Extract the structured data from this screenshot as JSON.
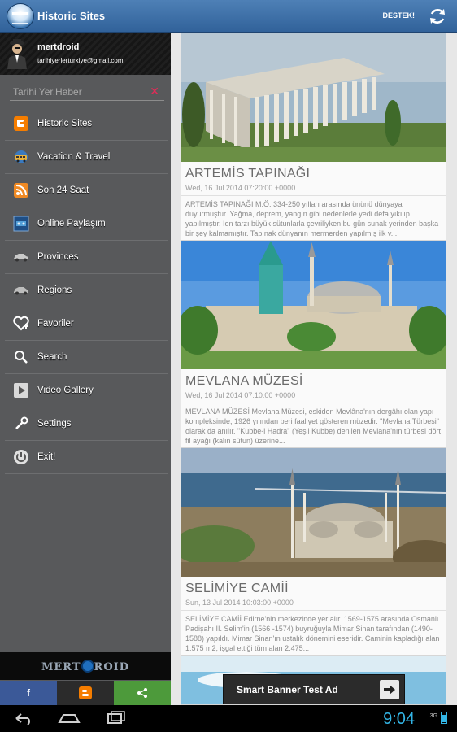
{
  "app": {
    "title": "Historic Sites",
    "support_label": "DESTEK!"
  },
  "user": {
    "name": "mertdroid",
    "email": "tarihiyerlerturkiye@gmail.com"
  },
  "search": {
    "placeholder": "Tarihi Yer,Haber",
    "clear_icon": "close-icon"
  },
  "menu": [
    {
      "label": "Historic Sites",
      "icon": "blogger-icon"
    },
    {
      "label": "Vacation & Travel",
      "icon": "bus-icon"
    },
    {
      "label": "Son 24 Saat",
      "icon": "rss-icon"
    },
    {
      "label": "Online Paylaşım",
      "icon": "share-screen-icon"
    },
    {
      "label": "Provinces",
      "icon": "car-icon"
    },
    {
      "label": "Regions",
      "icon": "map-pin-icon"
    },
    {
      "label": "Favoriler",
      "icon": "heart-plus-icon"
    },
    {
      "label": "Search",
      "icon": "search-icon"
    },
    {
      "label": "Video Gallery",
      "icon": "play-icon"
    },
    {
      "label": "Settings",
      "icon": "wrench-icon"
    },
    {
      "label": "Exit!",
      "icon": "power-icon"
    }
  ],
  "brand": {
    "left": "MERT",
    "right": "ROID"
  },
  "share": [
    {
      "label": "f",
      "icon": "facebook-icon",
      "color": "#3b5998"
    },
    {
      "label": "B",
      "icon": "blogger-icon",
      "color": "#2b2b2b"
    },
    {
      "label": "share",
      "icon": "share-icon",
      "color": "#4d9a3b"
    }
  ],
  "articles": [
    {
      "title": "ARTEMİS TAPINAĞI",
      "date": "Wed, 16 Jul 2014 07:20:00 +0000",
      "text": "ARTEMİS TAPINAĞI M.Ö. 334-250 yılları arasında ününü dünyaya duyurmuştur. Yağma, deprem, yangın gibi nedenlerle yedi defa yıkılıp yapılmıştır. İon tarzı büyük sütunlarla çevriliyken bu gün sunak yerinden başka bir şey kalmamıştır. Tapınak dünyanın mermerden yapılmış ilk v..."
    },
    {
      "title": "MEVLANA MÜZESİ",
      "date": "Wed, 16 Jul 2014 07:10:00 +0000",
      "text": "MEVLANA MÜZESİ Mevlana Müzesi, eskiden Mevlâna'nın dergâhı olan yapı kompleksinde, 1926 yılından beri faaliyet gösteren müzedir. \"Mevlana Türbesi\" olarak da anılır. \"Kubbe-i Hadra\" (Yeşil Kubbe) denilen Mevlana'nın türbesi dört fil ayağı (kalın sütun) üzerine..."
    },
    {
      "title": "SELİMİYE CAMİİ",
      "date": "Sun, 13 Jul 2014 10:03:00 +0000",
      "text": "SELİMİYE CAMİİ Edirne'nin merkezinde yer alır. 1569-1575 arasında Osmanlı Padişahı II. Selim'in (1566 -1574) buyruğuyla Mimar Sinan tarafından (1490-1588) yapıldı. Mimar Sinan'ın ustalık dönemini eseridir. Caminin kapladığı alan 1.575 m2, işgal ettiği tüm alan 2.475..."
    }
  ],
  "ad": {
    "text": "Smart Banner Test Ad"
  },
  "status": {
    "time": "9:04",
    "network": "3G"
  }
}
